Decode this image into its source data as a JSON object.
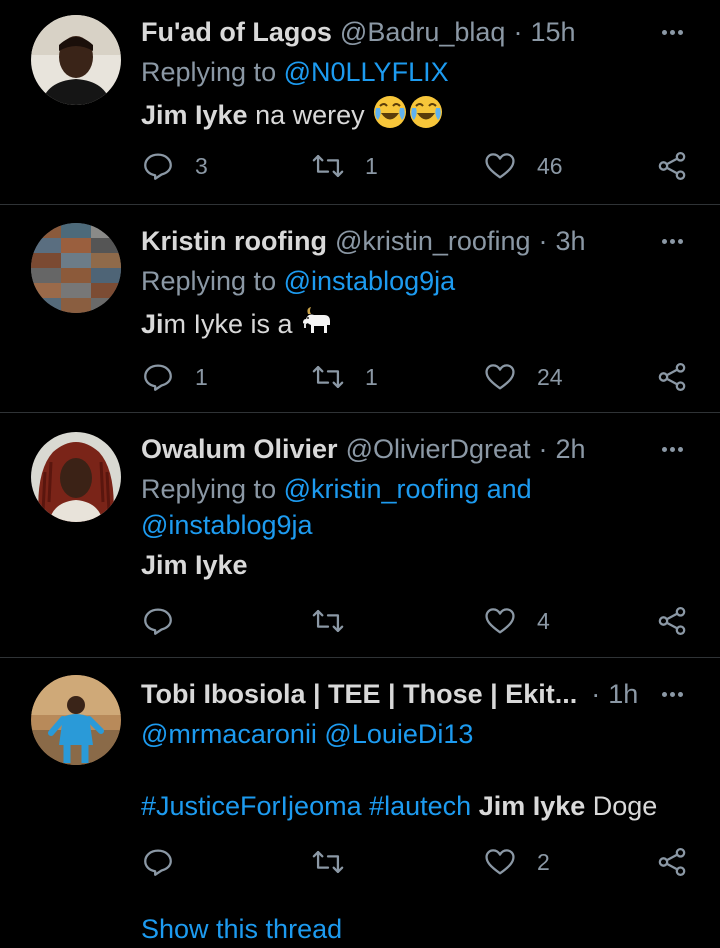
{
  "tweets": [
    {
      "name": "Fu'ad of Lagos",
      "handle": "@Badru_blaq",
      "dot": "·",
      "time": "15h",
      "replying_prefix": "Replying to",
      "replying_to": "@N0LLYFLIX",
      "text_bold": "Jim Iyke",
      "text_rest": " na werey",
      "replies": "3",
      "retweets": "1",
      "likes": "46",
      "emoji": "face-with-tears-of-joy x2"
    },
    {
      "name": "Kristin roofing",
      "handle": "@kristin_roofing",
      "dot": "·",
      "time": "3h",
      "replying_prefix": "Replying to",
      "replying_to": "@instablog9ja",
      "text_bold": "Ji",
      "text_rest": "m Iyke is a",
      "replies": "1",
      "retweets": "1",
      "likes": "24",
      "emoji": "goat"
    },
    {
      "name": "Owalum Olivier",
      "handle": "@OlivierDgreat",
      "dot": "·",
      "time": "2h",
      "replying_prefix": "Replying to",
      "replying_to": "@kristin_roofing and",
      "replying_to_2": "@instablog9ja",
      "text_bold": "Jim Iyke",
      "likes": "4"
    },
    {
      "name": "Tobi Ibosiola | TEE | Those | Ekit...",
      "dot": "·",
      "time": "1h",
      "mentions": "@mrmacaronii @LouieDi13",
      "hashtags": "#JusticeForIjeoma #lautech",
      "text_bold": "Jim Iyke",
      "text_rest": " Doge",
      "likes": "2"
    }
  ],
  "show_thread": "Show this thread",
  "colors": {
    "background": "#000000",
    "text": "#d9d9d9",
    "secondary": "#8b98a5",
    "link": "#1d9bf0",
    "divider": "#2f3336"
  }
}
